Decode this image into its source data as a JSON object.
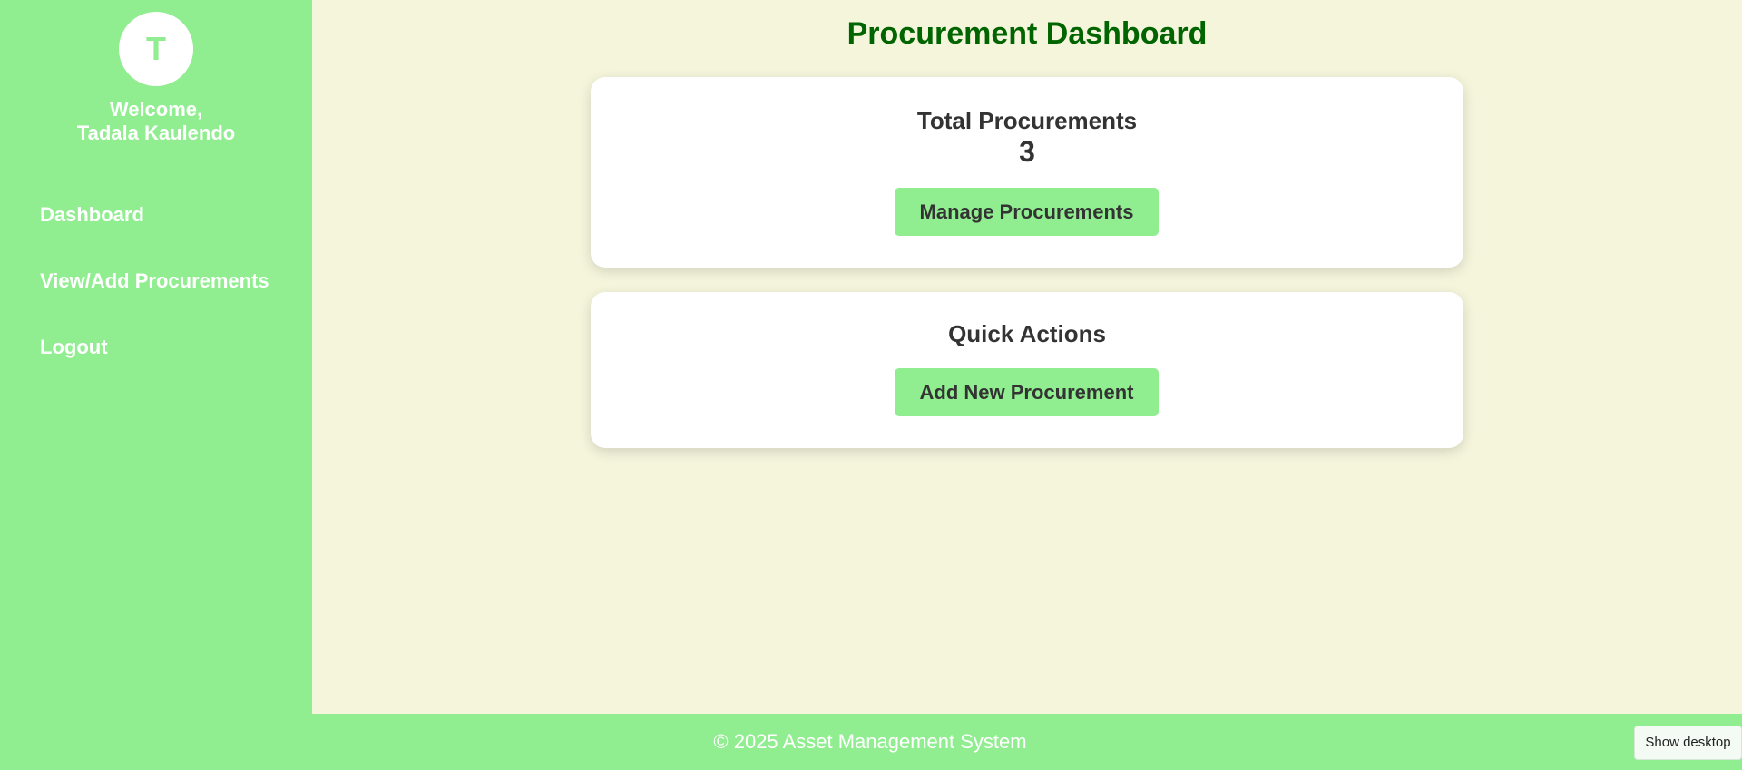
{
  "colors": {
    "sidebar_bg": "#90ee90",
    "page_bg": "#f5f5dc",
    "title_color": "#006400",
    "button_bg": "#90ee90",
    "card_bg": "#ffffff"
  },
  "sidebar": {
    "avatar_initial": "T",
    "welcome_line1": "Welcome,",
    "welcome_line2": "Tadala Kaulendo",
    "items": [
      {
        "label": "Dashboard"
      },
      {
        "label": "View/Add Procurements"
      },
      {
        "label": "Logout"
      }
    ]
  },
  "main": {
    "title": "Procurement Dashboard",
    "total_card": {
      "heading": "Total Procurements",
      "value": "3",
      "button_label": "Manage Procurements"
    },
    "quick_card": {
      "heading": "Quick Actions",
      "button_label": "Add New Procurement"
    }
  },
  "footer": {
    "text": "© 2025 Asset Management System"
  },
  "taskbar": {
    "show_desktop_label": "Show desktop"
  }
}
